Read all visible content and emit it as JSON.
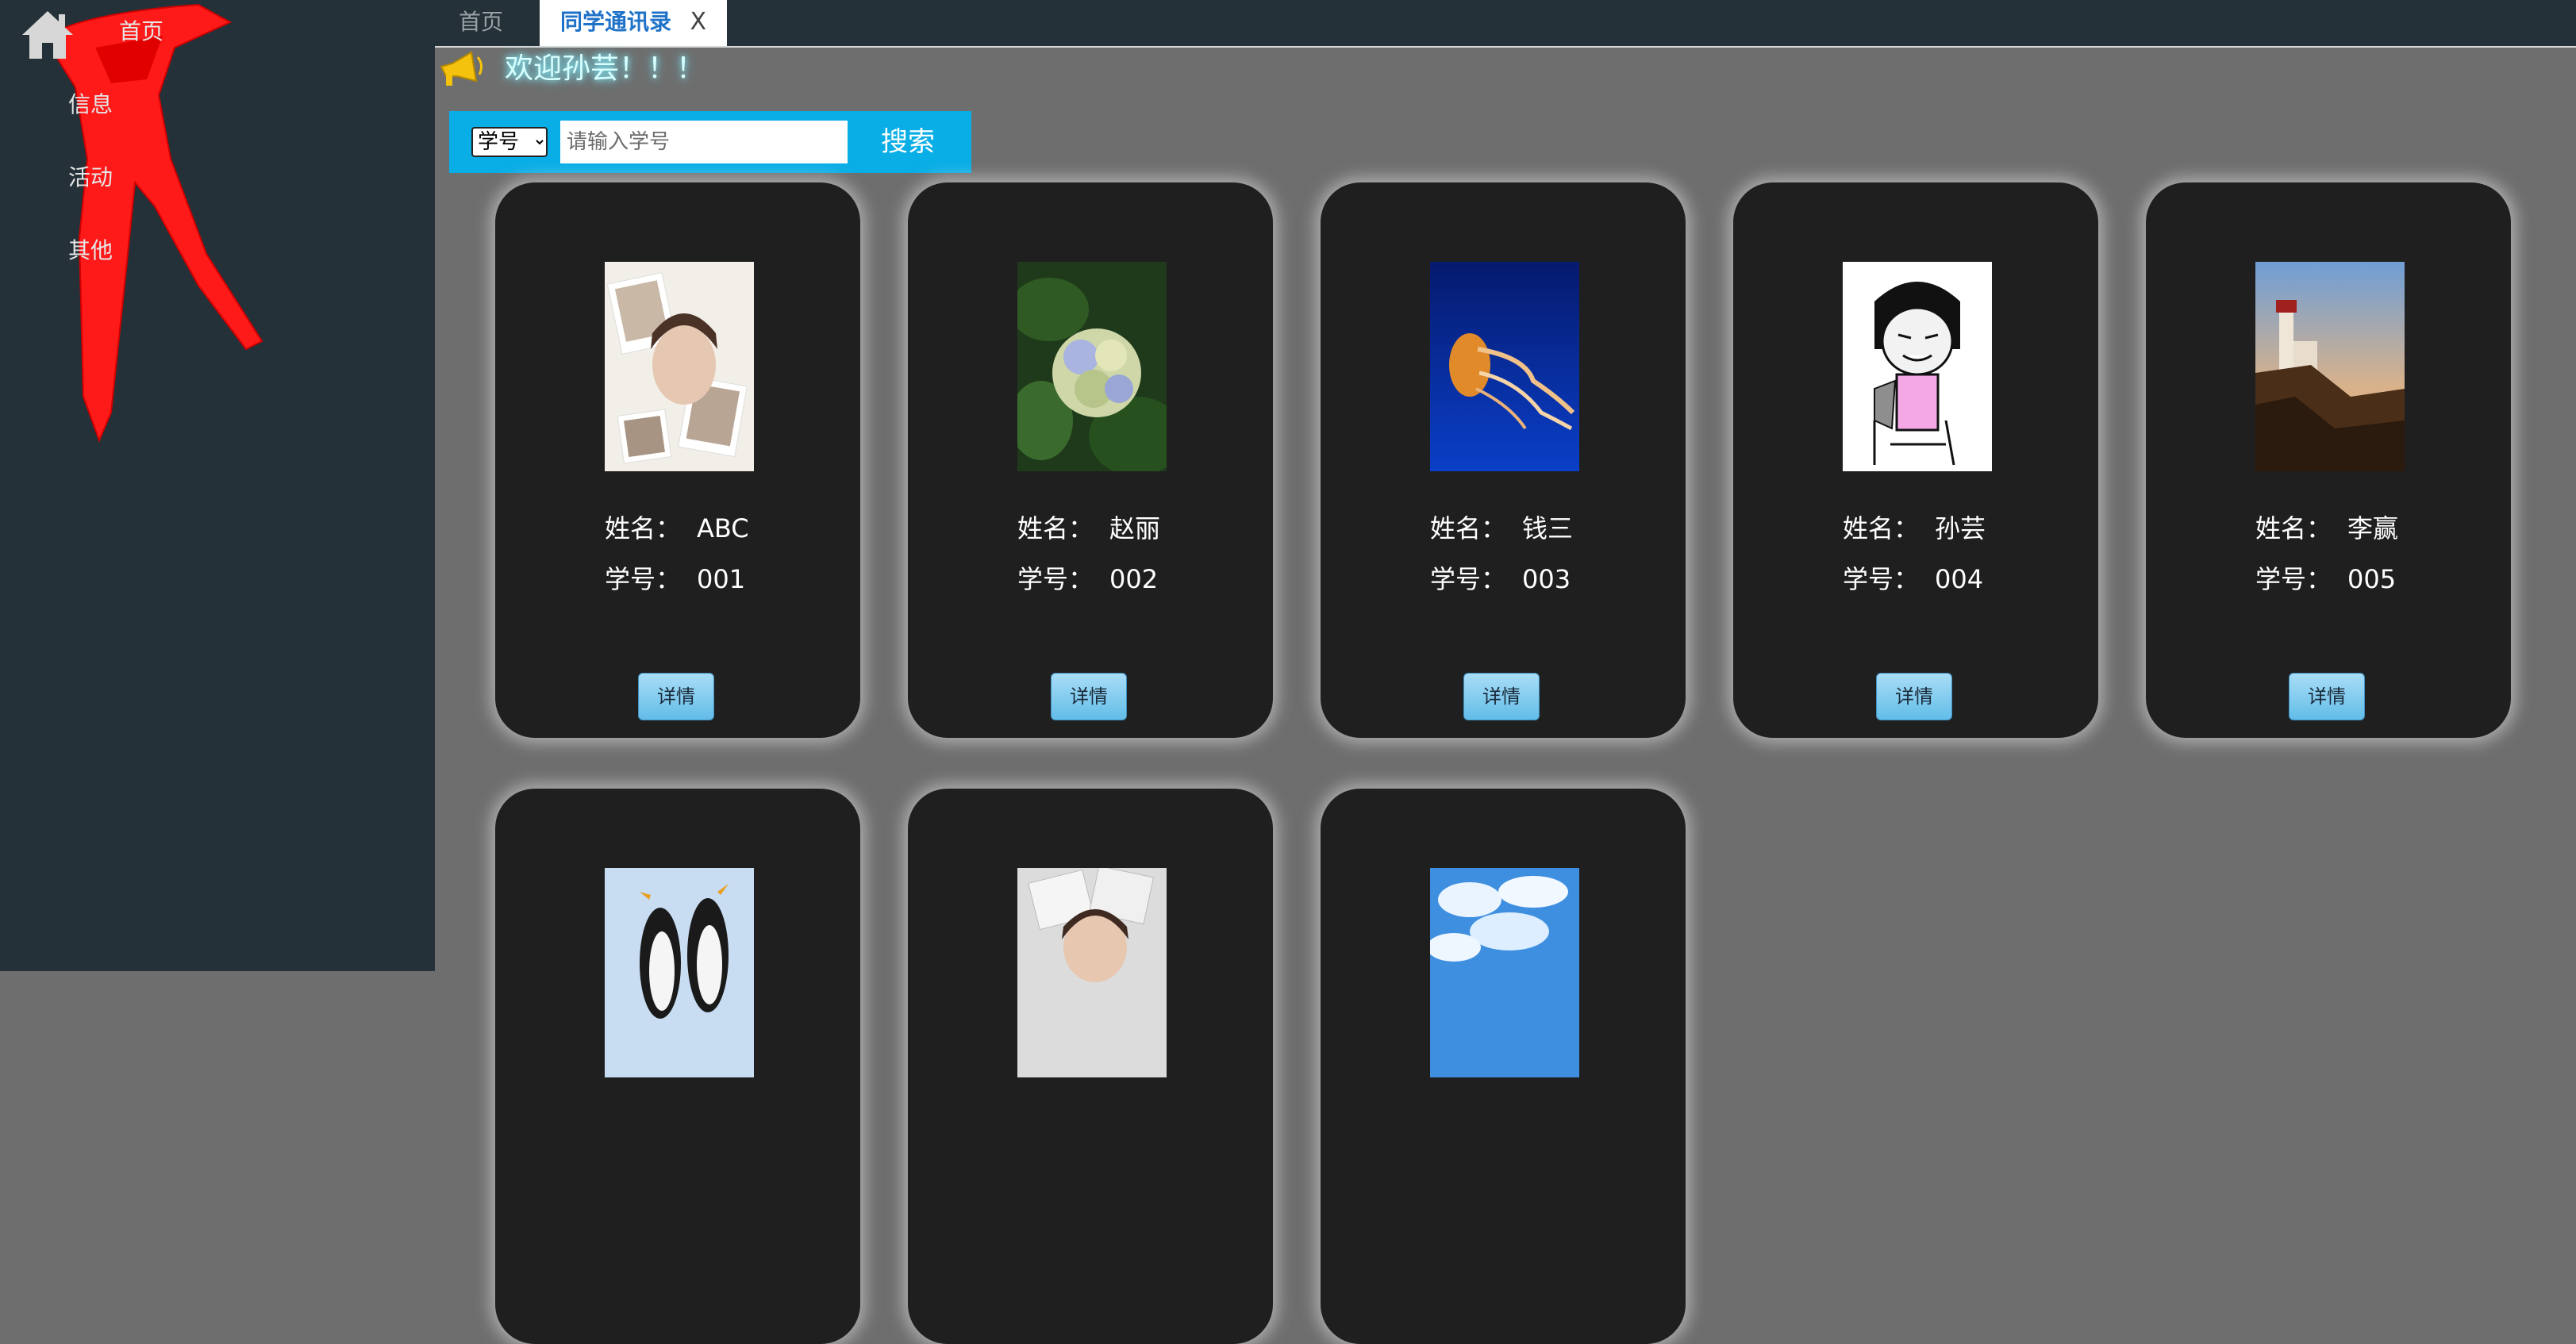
{
  "sidebar": {
    "items": [
      {
        "label": "首页"
      },
      {
        "label": "信息"
      },
      {
        "label": "活动"
      },
      {
        "label": "其他"
      }
    ]
  },
  "tabs": [
    {
      "label": "首页"
    },
    {
      "label": "同学通讯录",
      "close_label": "X",
      "active": true
    }
  ],
  "welcome": {
    "text": "欢迎孙芸！！！",
    "icon": "speaker-icon"
  },
  "search": {
    "field_options": [
      "学号"
    ],
    "selected_field": "学号",
    "placeholder": "请输入学号",
    "value": "",
    "button_label": "搜索"
  },
  "card_labels": {
    "name_label": "姓名：",
    "id_label": "学号：",
    "detail_label": "详情"
  },
  "students": [
    {
      "name": "ABC",
      "id": "001",
      "photo": "girl-photo-collage"
    },
    {
      "name": "赵丽",
      "id": "002",
      "photo": "hydrangea-flower"
    },
    {
      "name": "钱三",
      "id": "003",
      "photo": "jellyfish"
    },
    {
      "name": "孙芸",
      "id": "004",
      "photo": "cartoon-meme-face"
    },
    {
      "name": "李赢",
      "id": "005",
      "photo": "lighthouse"
    },
    {
      "photo": "penguins"
    },
    {
      "photo": "girl-photo"
    },
    {
      "photo": "sky-clouds"
    }
  ],
  "colors": {
    "sidebar_bg": "#253139",
    "content_bg": "#6e6e6e",
    "card_bg": "#1f1f1f",
    "search_bar": "#0aaee6",
    "active_tab_text": "#1f72c8",
    "scarf": "#ff1a1a"
  }
}
